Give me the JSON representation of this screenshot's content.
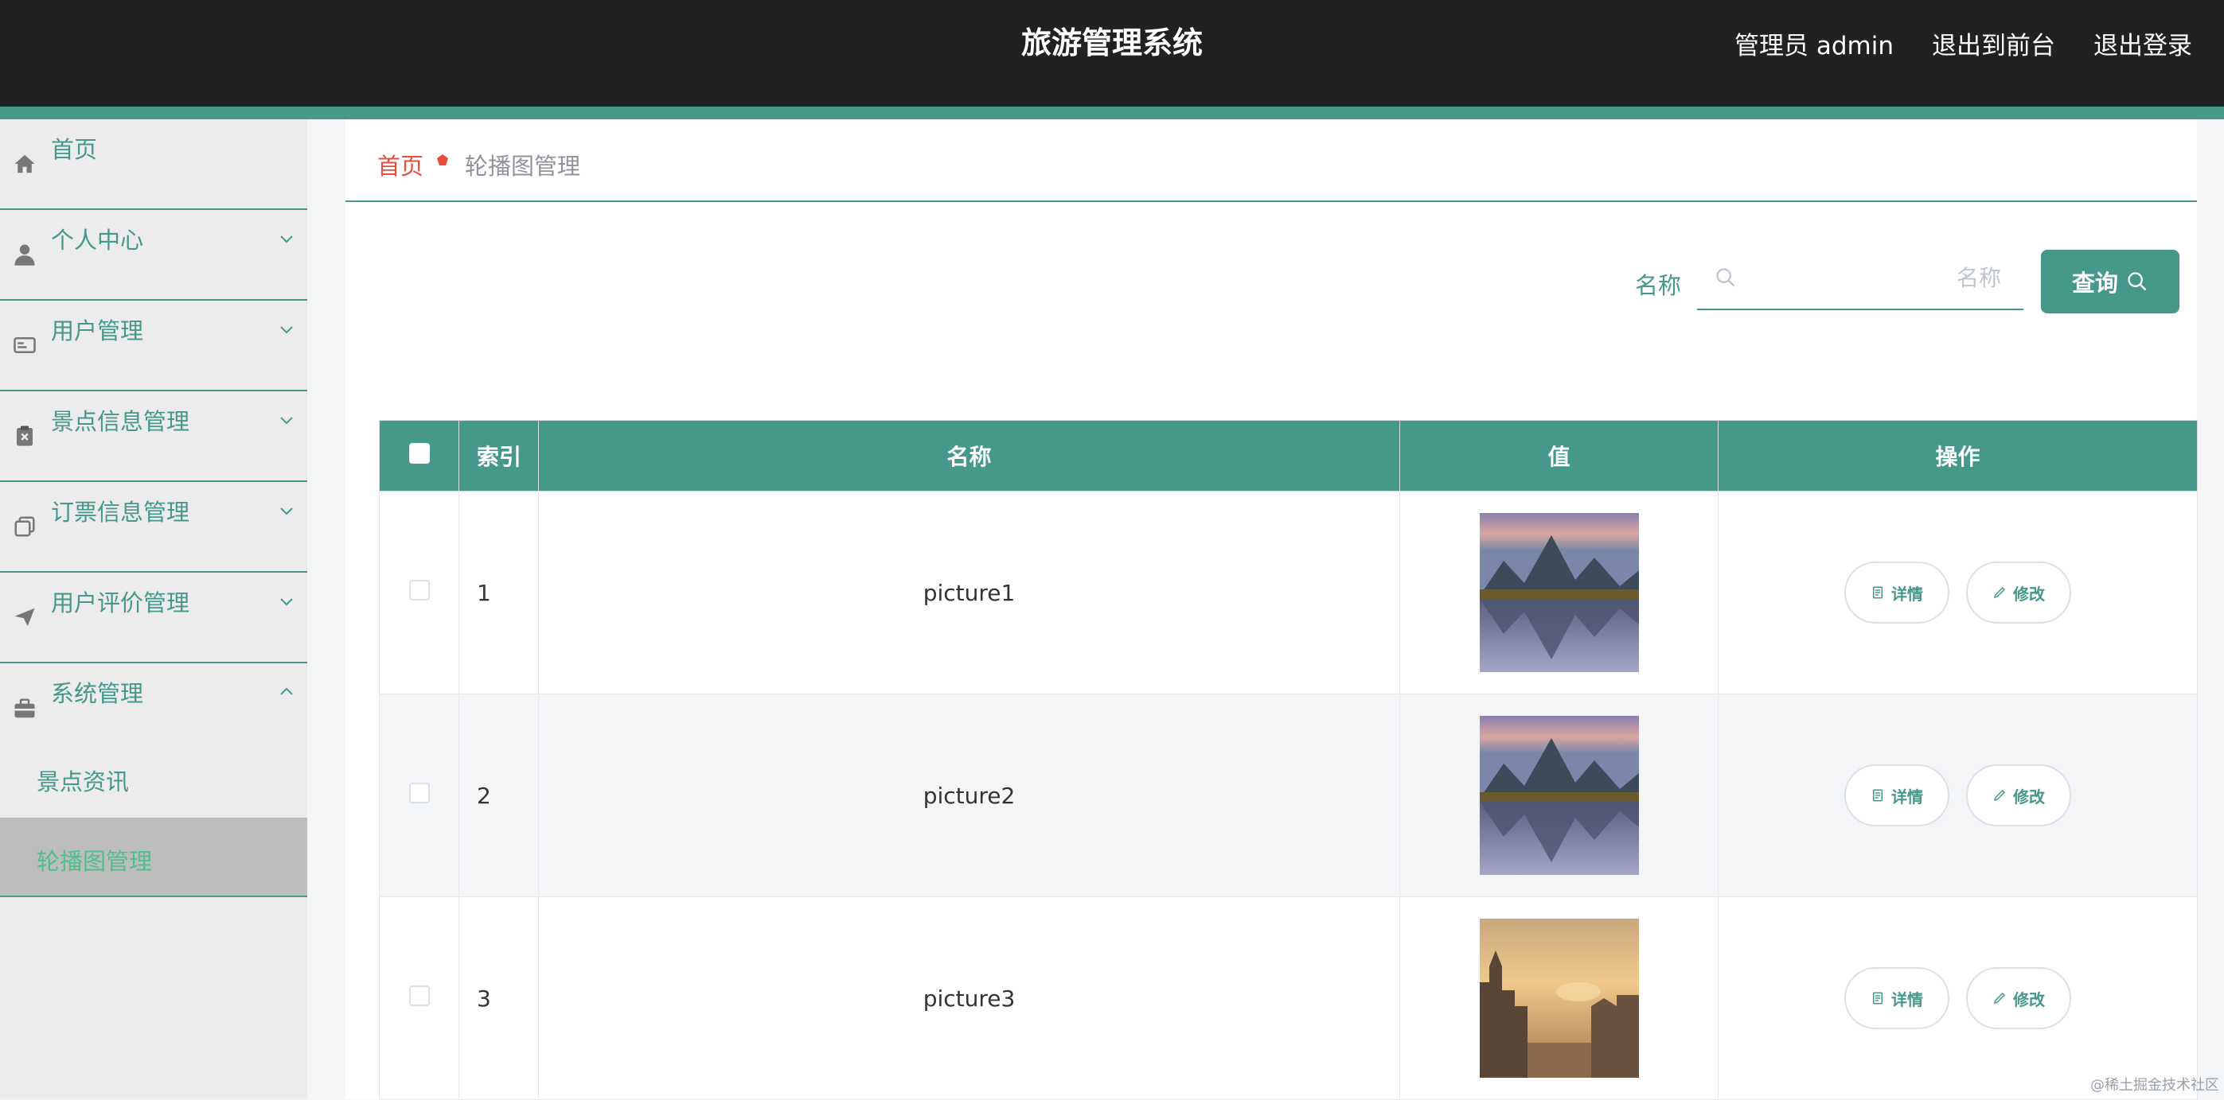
{
  "header": {
    "title": "旅游管理系统",
    "admin_label": "管理员 admin",
    "to_front_label": "退出到前台",
    "logout_label": "退出登录"
  },
  "sidebar": {
    "items": [
      {
        "label": "首页",
        "icon": "home-icon"
      },
      {
        "label": "个人中心",
        "icon": "user-icon"
      },
      {
        "label": "用户管理",
        "icon": "id-card-icon"
      },
      {
        "label": "景点信息管理",
        "icon": "clipboard-icon"
      },
      {
        "label": "订票信息管理",
        "icon": "copy-icon"
      },
      {
        "label": "用户评价管理",
        "icon": "send-icon"
      },
      {
        "label": "系统管理",
        "icon": "briefcase-icon"
      }
    ],
    "sub_items": [
      {
        "label": "景点资讯"
      },
      {
        "label": "轮播图管理"
      }
    ]
  },
  "breadcrumb": {
    "home": "首页",
    "current": "轮播图管理"
  },
  "search": {
    "label": "名称",
    "placeholder": "名称",
    "button_label": "查询"
  },
  "table": {
    "headers": {
      "index": "索引",
      "name": "名称",
      "value": "值",
      "actions": "操作"
    },
    "rows": [
      {
        "index": "1",
        "name": "picture1",
        "image": "mountain-lake-image"
      },
      {
        "index": "2",
        "name": "picture2",
        "image": "mountain-lake-image"
      },
      {
        "index": "3",
        "name": "picture3",
        "image": "sunset-town-image"
      }
    ],
    "actions": {
      "detail": "详情",
      "edit": "修改"
    }
  },
  "watermark": "@稀土掘金技术社区",
  "colors": {
    "accent": "#45988a",
    "header_bg": "#212121",
    "breadcrumb_home": "#e74c3c",
    "active_sub": "#4fc08d"
  }
}
